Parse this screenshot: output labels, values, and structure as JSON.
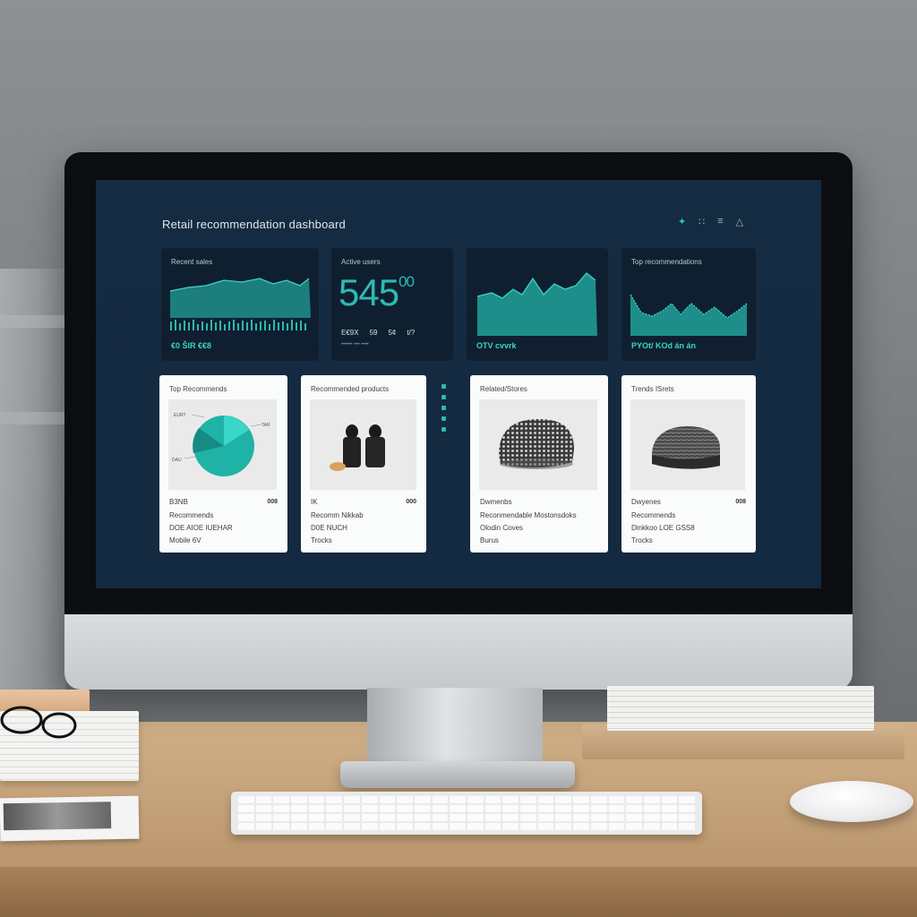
{
  "dashboard": {
    "title": "Retail recommendation dashboard",
    "top_icons": [
      "✦",
      "∷",
      "≡",
      "△"
    ]
  },
  "stats": [
    {
      "label": "Recent sales",
      "type": "area-chart",
      "footer": "€0 ŠIR  €€8"
    },
    {
      "label": "Active users",
      "type": "number",
      "value": "545",
      "value_suffix": "00",
      "mini_stats": [
        "E€9X",
        "59",
        "5¢",
        "t/?"
      ],
      "mini_sub": "••••••   •••   ••••"
    },
    {
      "label": "",
      "type": "area-chart",
      "footer": "OTV  cvvrk"
    },
    {
      "label": "Top recommendations",
      "type": "area-chart",
      "footer": "PYOt/ KOd án án"
    }
  ],
  "cards": [
    {
      "title": "Top Recommends",
      "image": "pie-chart",
      "lines": [
        "B3NB",
        "Recommends",
        "DOE  AIOE  IUEHAR",
        "Mobile 6V"
      ],
      "price": "008"
    },
    {
      "title": "Recommended products",
      "image": "figurines",
      "lines": [
        "IK",
        "Recomm  Nikkab",
        "D0E  NUCH",
        "Trocks"
      ],
      "price": "000"
    },
    {
      "title": "Related/Stores",
      "image": "knit-beanie",
      "lines": [
        "Dwmenbs",
        "Reconmendable  Mostonsdoks",
        "Olodin Coves",
        "Burus"
      ],
      "price": ""
    },
    {
      "title": "Trends ISrets",
      "image": "wool-hat",
      "lines": [
        "Dwyenes",
        "Recommends",
        "Dinkkoo  LOE  GSS8",
        "Trocks"
      ],
      "price": "008"
    }
  ],
  "pie": {
    "labels": [
      "EURT",
      "TAR",
      "DAU"
    ],
    "colors": [
      "#1fb3a8",
      "#3ad6c8",
      "#178a83"
    ]
  },
  "colors": {
    "accent": "#2fc7be",
    "screen_bg": "#142a40",
    "panel_bg": "#0f1f30",
    "card_bg": "#fafbfb"
  }
}
